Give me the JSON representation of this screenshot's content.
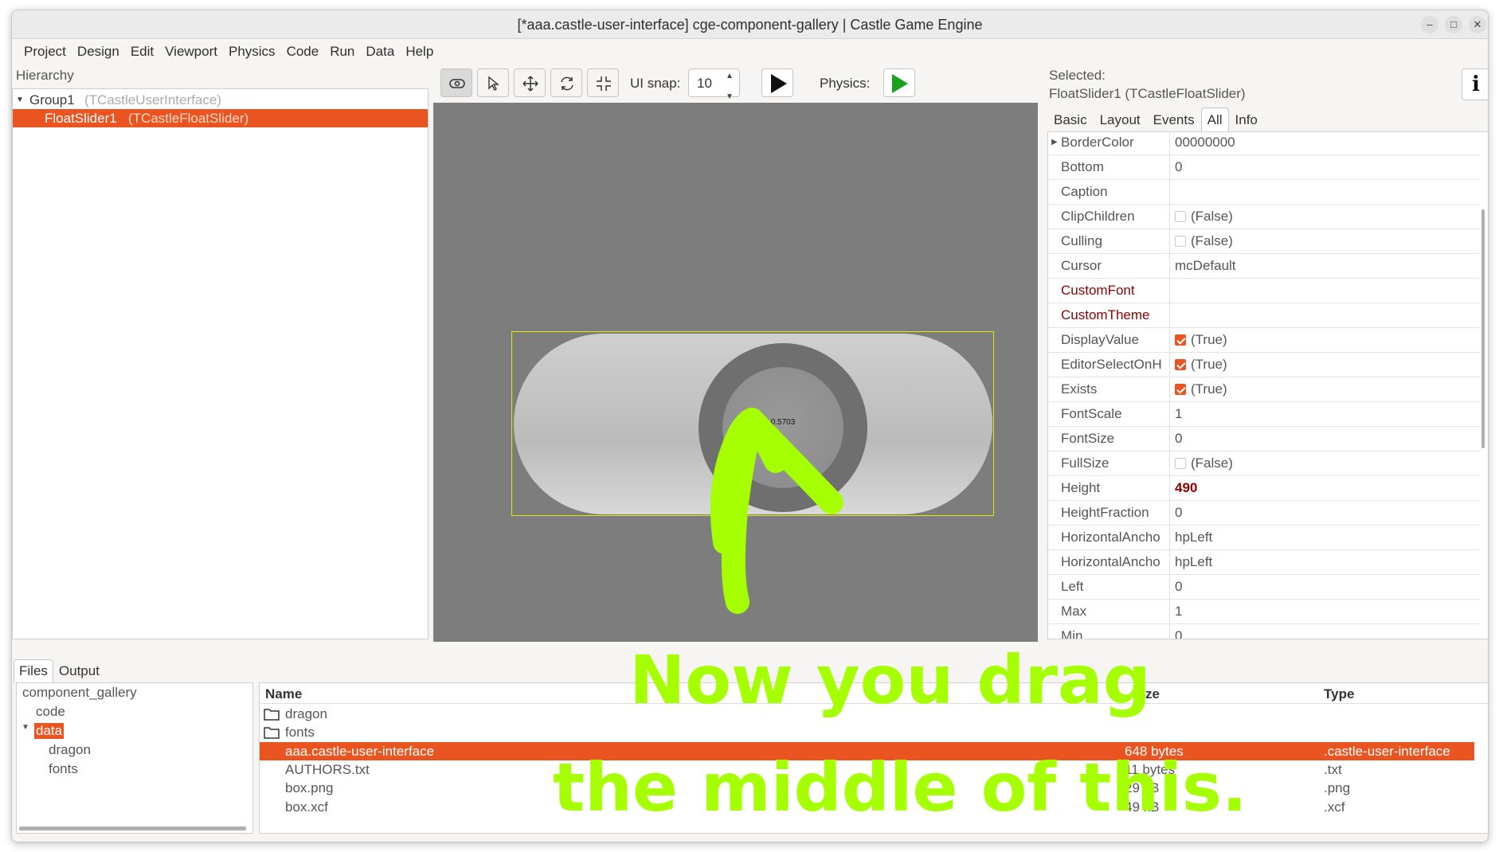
{
  "window": {
    "title": "[*aaa.castle-user-interface] cge-component-gallery | Castle Game Engine"
  },
  "window_controls": [
    "–",
    "□",
    "✕"
  ],
  "menu": [
    "Project",
    "Design",
    "Edit",
    "Viewport",
    "Physics",
    "Code",
    "Run",
    "Data",
    "Help"
  ],
  "hierarchy": {
    "label": "Hierarchy",
    "items": [
      {
        "name": "Group1",
        "type": "(TCastleUserInterface)"
      },
      {
        "name": "FloatSlider1",
        "type": "(TCastleFloatSlider)"
      }
    ]
  },
  "toolbar": {
    "tools": [
      "interact-icon",
      "select-icon",
      "translate-icon",
      "rotate-icon",
      "scale-icon"
    ],
    "ui_snap_label": "UI snap:",
    "ui_snap_value": "10",
    "physics_label": "Physics:"
  },
  "viewport": {
    "slider_value": "0.5703"
  },
  "inspector": {
    "selected_label": "Selected:",
    "selected_value": "FloatSlider1 (TCastleFloatSlider)",
    "info_button": "i",
    "tabs": [
      "Basic",
      "Layout",
      "Events",
      "All",
      "Info"
    ],
    "active_tab": "All",
    "properties": [
      {
        "name": "BorderColor",
        "value": "00000000",
        "expandable": true
      },
      {
        "name": "Bottom",
        "value": "0"
      },
      {
        "name": "Caption",
        "value": ""
      },
      {
        "name": "ClipChildren",
        "value": "(False)",
        "check": "off"
      },
      {
        "name": "Culling",
        "value": "(False)",
        "check": "off"
      },
      {
        "name": "Cursor",
        "value": "mcDefault"
      },
      {
        "name": "CustomFont",
        "value": "",
        "highlight": true
      },
      {
        "name": "CustomTheme",
        "value": "",
        "highlight": true
      },
      {
        "name": "DisplayValue",
        "value": "(True)",
        "check": "on"
      },
      {
        "name": "EditorSelectOnH",
        "value": "(True)",
        "check": "on"
      },
      {
        "name": "Exists",
        "value": "(True)",
        "check": "on"
      },
      {
        "name": "FontScale",
        "value": "1"
      },
      {
        "name": "FontSize",
        "value": "0"
      },
      {
        "name": "FullSize",
        "value": "(False)",
        "check": "off"
      },
      {
        "name": "Height",
        "value": "490",
        "modified": true
      },
      {
        "name": "HeightFraction",
        "value": "0"
      },
      {
        "name": "HorizontalAncho",
        "value": "hpLeft"
      },
      {
        "name": "HorizontalAncho",
        "value": "hpLeft"
      },
      {
        "name": "Left",
        "value": "0"
      },
      {
        "name": "Max",
        "value": "1"
      },
      {
        "name": "Min",
        "value": "0"
      }
    ]
  },
  "bottom": {
    "tabs": [
      "Files",
      "Output"
    ],
    "active_tab": "Files",
    "dir_tree": [
      {
        "name": "component_gallery"
      },
      {
        "name": "code"
      },
      {
        "name": "data",
        "selected": true
      },
      {
        "name": "dragon"
      },
      {
        "name": "fonts"
      }
    ],
    "columns": [
      "Name",
      "Size",
      "Type"
    ],
    "files": [
      {
        "name": "dragon",
        "size": "",
        "type": "",
        "folder": true
      },
      {
        "name": "fonts",
        "size": "",
        "type": "",
        "folder": true
      },
      {
        "name": "aaa.castle-user-interface",
        "size": "648 bytes",
        "type": ".castle-user-interface",
        "selected": true
      },
      {
        "name": "AUTHORS.txt",
        "size": "11 bytes",
        "type": ".txt"
      },
      {
        "name": "box.png",
        "size": "29 kB",
        "type": ".png"
      },
      {
        "name": "box.xcf",
        "size": "49 kB",
        "type": ".xcf"
      }
    ]
  },
  "overlay": {
    "line1": "Now you drag",
    "line2": "the middle of this."
  },
  "colors": {
    "accent": "#e95420",
    "overlay": "#a6ff00",
    "modified": "#8b0000"
  }
}
